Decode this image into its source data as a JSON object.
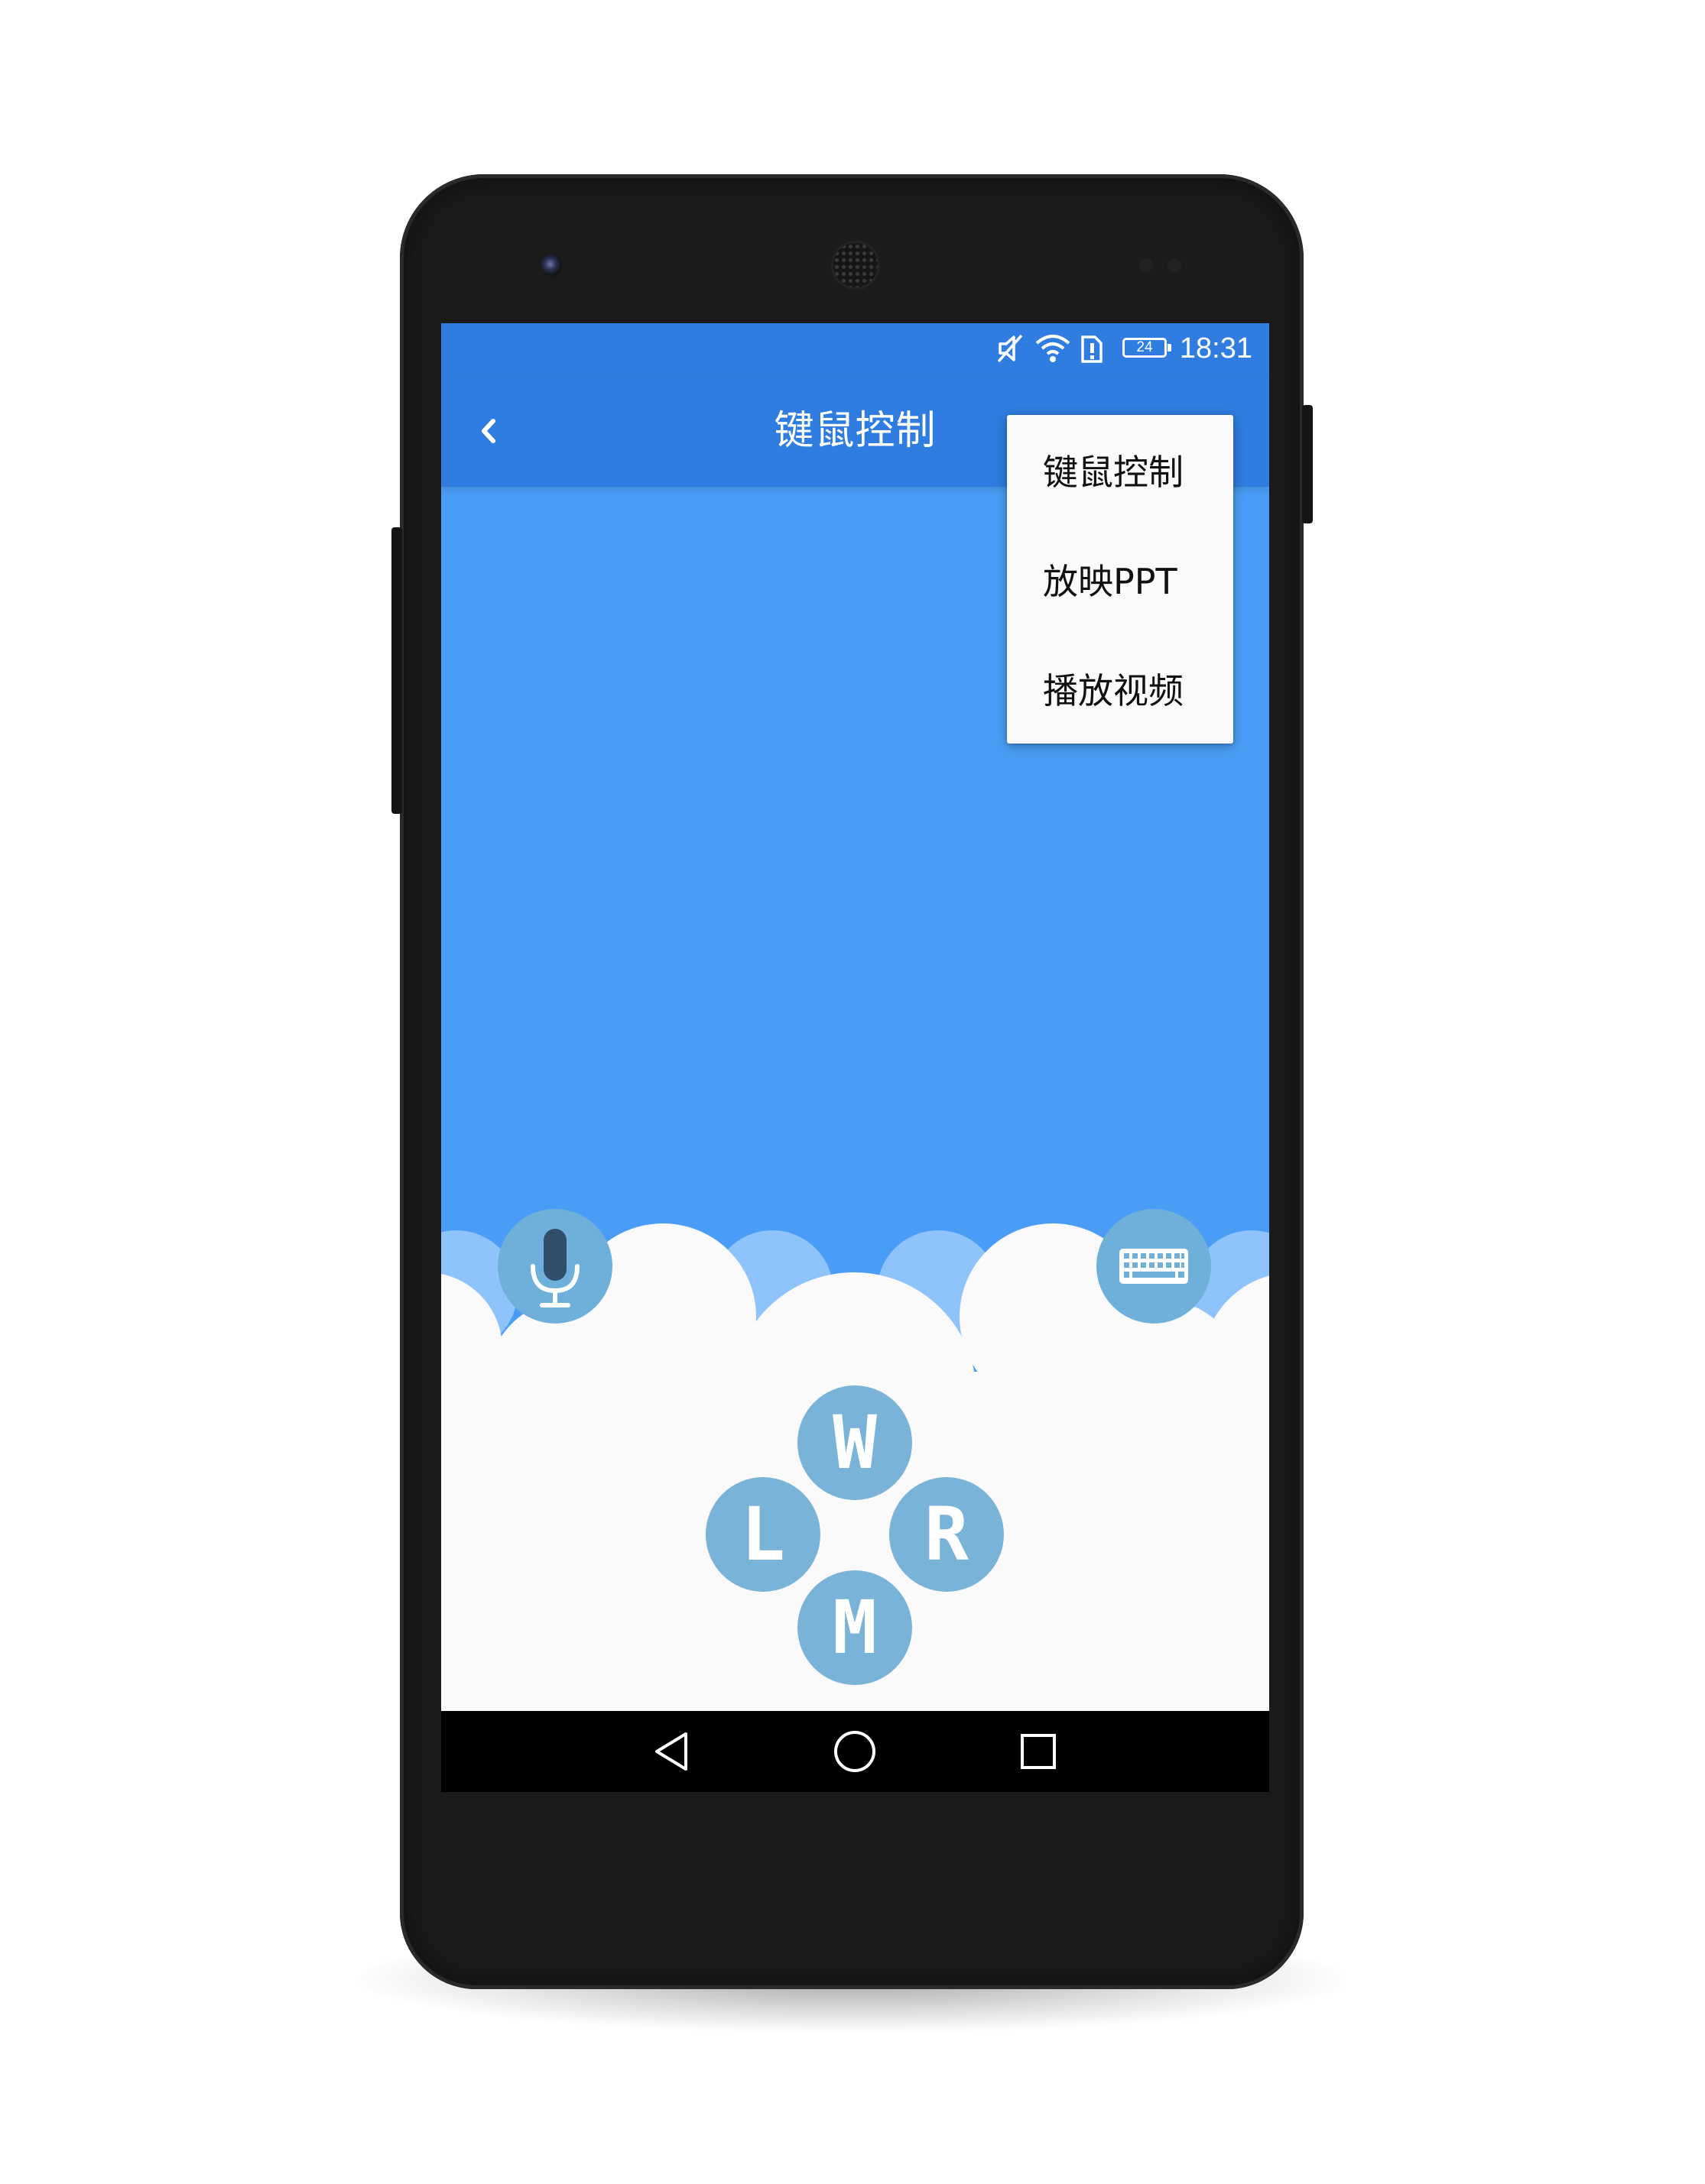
{
  "status_bar": {
    "battery_level": "24",
    "time": "18:31",
    "icons": [
      "mute-icon",
      "wifi-icon",
      "sim-alert-icon",
      "battery-icon"
    ]
  },
  "toolbar": {
    "title": "键鼠控制",
    "back_icon": "chevron-left-icon"
  },
  "overflow_menu": {
    "items": [
      {
        "label": "键鼠控制"
      },
      {
        "label": "放映PPT"
      },
      {
        "label": "播放视频"
      }
    ]
  },
  "controls": {
    "voice_icon": "microphone-icon",
    "keyboard_icon": "keyboard-icon",
    "buttons": {
      "up": "W",
      "left": "L",
      "right": "R",
      "down": "M"
    }
  },
  "nav_bar": {
    "icons": [
      "back-triangle-icon",
      "home-circle-icon",
      "recents-square-icon"
    ]
  },
  "colors": {
    "toolbar": "#2f7de0",
    "touchpad": "#4a9df6",
    "cloud_light": "#8fc3fb",
    "button": "#79b4d8",
    "menu_bg": "#fafafa"
  }
}
